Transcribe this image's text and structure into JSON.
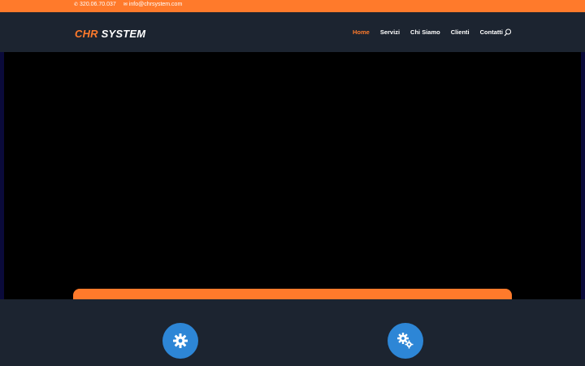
{
  "topbar": {
    "phone": "320.06.70.037",
    "email": "info@chrsystem.com",
    "phone_icon": "phone-icon",
    "email_icon": "envelope-icon"
  },
  "logo": {
    "part1": "CHR",
    "part2": "SYSTEM"
  },
  "nav": {
    "items": [
      {
        "label": "Home",
        "active": true
      },
      {
        "label": "Servizi",
        "active": false
      },
      {
        "label": "Chi Siamo",
        "active": false
      },
      {
        "label": "Clienti",
        "active": false
      },
      {
        "label": "Contatti",
        "active": false
      }
    ]
  },
  "features": {
    "icons": [
      "gear-icon",
      "gears-icon"
    ]
  },
  "colors": {
    "accent": "#ff7a2b",
    "header_bg": "#1c2430",
    "icon_circle": "#2d86d6",
    "hero_bg": "#000000"
  }
}
